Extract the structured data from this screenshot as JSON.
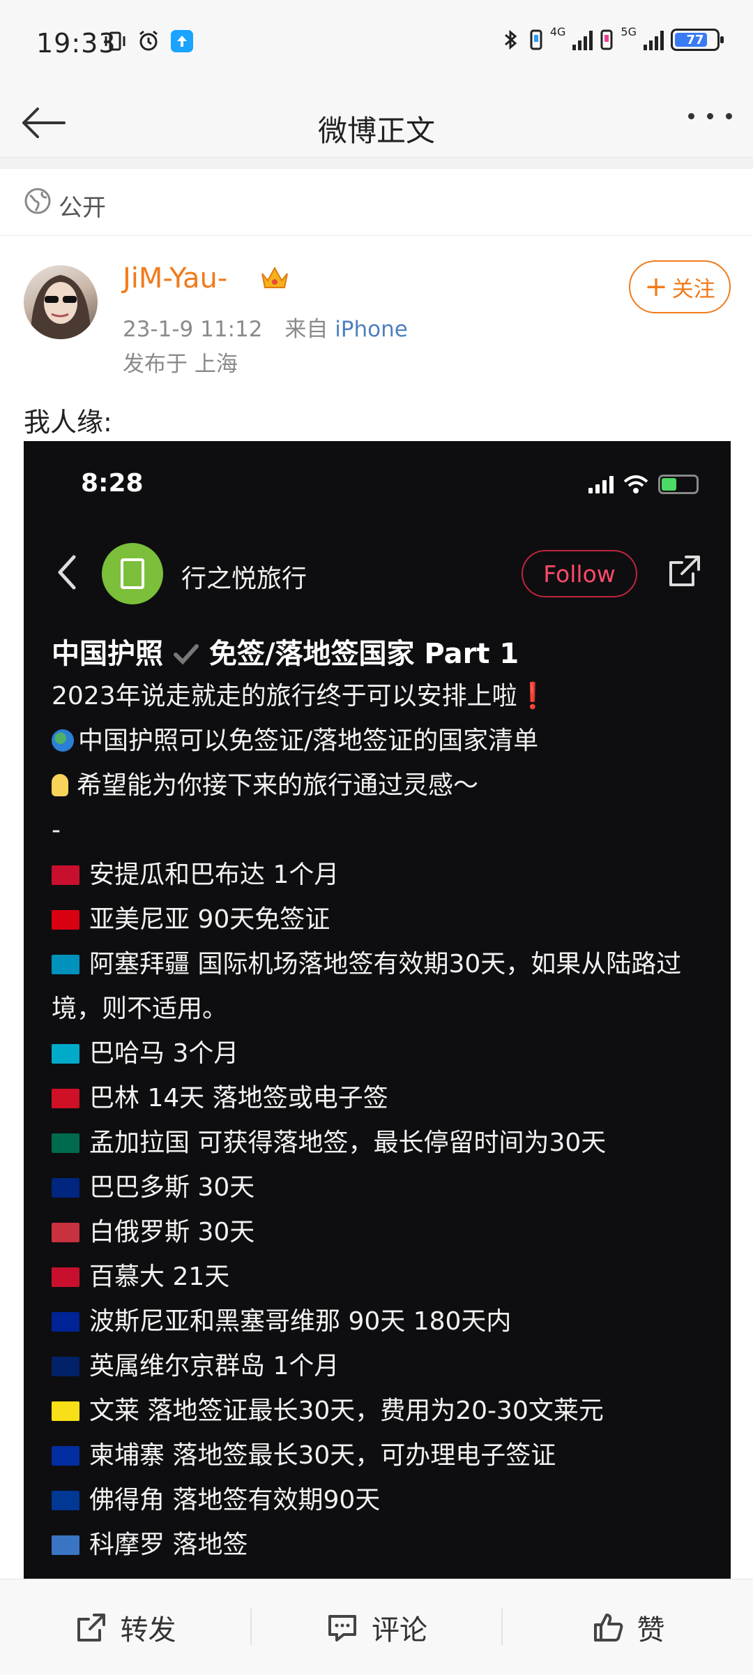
{
  "status_bar": {
    "time": "19:33",
    "network_1": "4G",
    "network_2": "5G",
    "battery": "77"
  },
  "nav": {
    "title": "微博正文"
  },
  "visibility": {
    "label": "公开"
  },
  "author": {
    "name": "JiM-Yau-",
    "date": "23-1-9 11:12",
    "source_prefix": "来自",
    "source": "iPhone",
    "location": "发布于 上海",
    "follow_label": "关注"
  },
  "post": {
    "text": "我人缘:"
  },
  "screenshot": {
    "time": "8:28",
    "account": "行之悦旅行",
    "follow_label": "Follow",
    "title_part1": "中国护照",
    "title_part2": "免签/落地签国家 Part 1",
    "lines": [
      "2023年说走就走的旅行终于可以安排上啦❗",
      "中国护照可以免签证/落地签证的国家清单",
      "希望能为你接下来的旅行通过灵感～",
      "-",
      "安提瓜和巴布达 1个月",
      "亚美尼亚 90天免签证",
      "阿塞拜疆 国际机场落地签有效期30天，如果从陆路过境，则不适用。",
      "巴哈马 3个月",
      "巴林 14天 落地签或电子签",
      "孟加拉国 可获得落地签，最长停留时间为30天",
      "巴巴多斯 30天",
      "白俄罗斯 30天",
      "百慕大 21天",
      "波斯尼亚和黑塞哥维那 90天 180天内",
      "英属维尔京群岛 1个月",
      "文莱 落地签证最长30天，费用为20-30文莱元",
      "柬埔寨 落地签最长30天，可办理电子签证",
      "佛得角 落地签有效期90天",
      "科摩罗 落地签"
    ],
    "flag_colors": [
      "#c8102e",
      "#d90012",
      "#0092bc",
      "#00abc9",
      "#ce1126",
      "#006a4e",
      "#00267f",
      "#c8313e",
      "#c8102e",
      "#002395",
      "#012169",
      "#f7e017",
      "#032ea1",
      "#003893",
      "#3a75c4"
    ]
  },
  "toolbar": {
    "repost": "转发",
    "comment": "评论",
    "like": "赞"
  }
}
